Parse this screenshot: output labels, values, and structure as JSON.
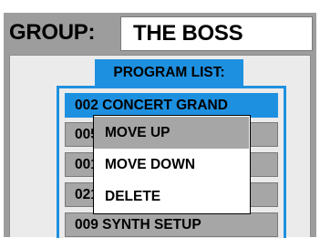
{
  "header": {
    "group_label": "GROUP:",
    "group_name": "THE BOSS"
  },
  "program_list": {
    "title": "PROGRAM LIST:",
    "items": [
      {
        "label": "002 CONCERT GRAND",
        "selected": true
      },
      {
        "label": "005",
        "selected": false
      },
      {
        "label": "001",
        "selected": false
      },
      {
        "label": "021",
        "selected": false
      },
      {
        "label": "009 SYNTH SETUP",
        "selected": false
      }
    ]
  },
  "context_menu": {
    "items": [
      {
        "label": "MOVE UP",
        "highlighted": true
      },
      {
        "label": "MOVE DOWN",
        "highlighted": false
      },
      {
        "label": "DELETE",
        "highlighted": false
      }
    ]
  },
  "colors": {
    "accent_blue": "#1e90e0",
    "frame_gray": "#9d9d9d",
    "item_gray": "#a6a6a6",
    "panel_light": "#ebebeb"
  }
}
